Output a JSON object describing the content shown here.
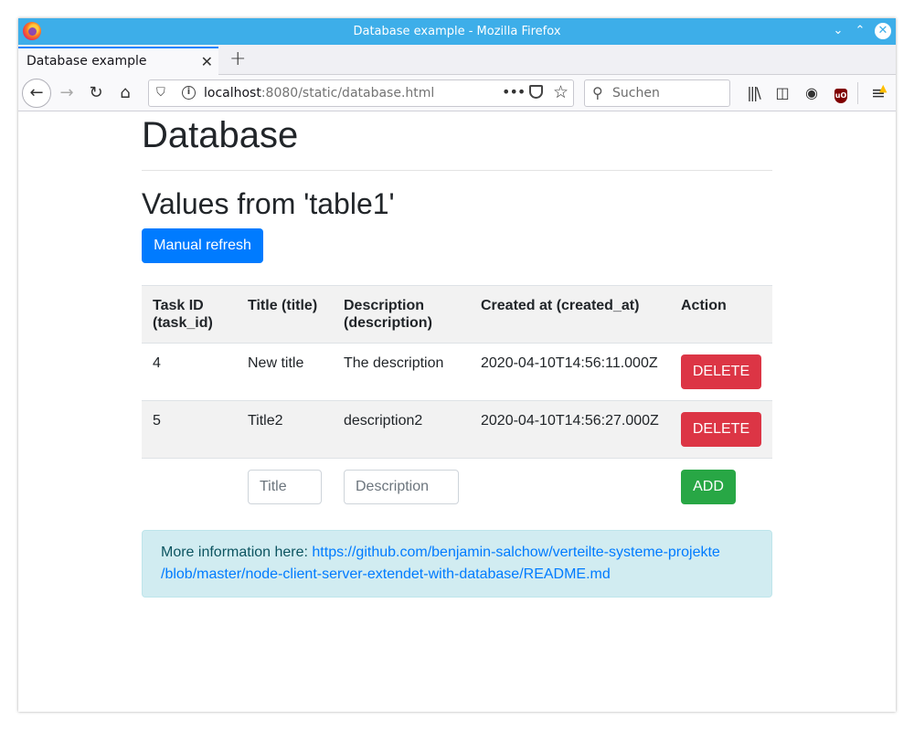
{
  "window": {
    "title": "Database example - Mozilla Firefox"
  },
  "tab": {
    "label": "Database example",
    "close": "✕",
    "new_tab": "+"
  },
  "navbar": {
    "url_host": "localhost",
    "url_rest": ":8080/static/database.html",
    "search_placeholder": "Suchen"
  },
  "page": {
    "heading": "Database",
    "subheading": "Values from 'table1'",
    "refresh_label": "Manual refresh",
    "columns": [
      "Task ID (task_id)",
      "Title (title)",
      "Description (description)",
      "Created at (created_at)",
      "Action"
    ],
    "rows": [
      {
        "task_id": "4",
        "title": "New title",
        "description": "The description",
        "created_at": "2020-04-10T14:56:11.000Z",
        "action": "DELETE"
      },
      {
        "task_id": "5",
        "title": "Title2",
        "description": "description2",
        "created_at": "2020-04-10T14:56:27.000Z",
        "action": "DELETE"
      }
    ],
    "new_row": {
      "title_placeholder": "Title",
      "description_placeholder": "Description",
      "add_label": "ADD"
    },
    "info": {
      "prefix": "More information here: ",
      "link_text_1": "https://github.com/benjamin-salchow/verteilte-systeme-projekte",
      "link_text_2": "/blob/master/node-client-server-extendet-with-database/README.md"
    }
  },
  "colors": {
    "titlebar": "#3daee9",
    "primary": "#007bff",
    "danger": "#dc3545",
    "success": "#28a745",
    "info_bg": "#d1ecf1"
  }
}
